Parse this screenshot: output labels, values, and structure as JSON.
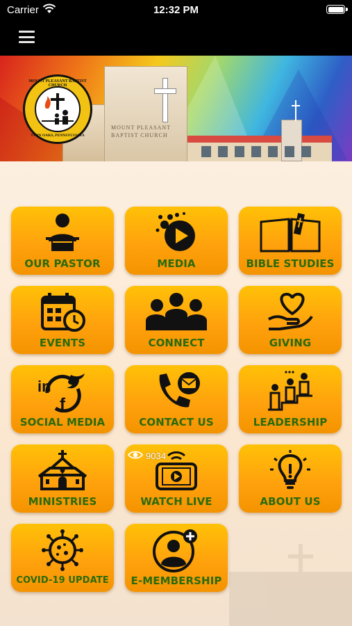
{
  "status_bar": {
    "carrier": "Carrier",
    "time": "12:32 PM"
  },
  "nav": {
    "menu_icon": "hamburger-menu-icon"
  },
  "hero": {
    "logo_text_top": "MOUNT PLEASANT BAPTIST CHURCH",
    "logo_text_bottom": "TWIN OAKS, PENNSYLVANIA",
    "sign_line1": "MOUNT PLEASANT",
    "sign_line2": "BAPTIST CHURCH"
  },
  "tiles": [
    {
      "label": "OUR PASTOR",
      "icon": "pastor-podium-icon"
    },
    {
      "label": "MEDIA",
      "icon": "media-play-icon"
    },
    {
      "label": "BIBLE STUDIES",
      "icon": "open-bible-icon"
    },
    {
      "label": "EVENTS",
      "icon": "calendar-clock-icon"
    },
    {
      "label": "CONNECT",
      "icon": "people-group-icon"
    },
    {
      "label": "GIVING",
      "icon": "hand-heart-icon"
    },
    {
      "label": "SOCIAL MEDIA",
      "icon": "social-media-icon"
    },
    {
      "label": "CONTACT US",
      "icon": "phone-mail-icon"
    },
    {
      "label": "LEADERSHIP",
      "icon": "leadership-stairs-icon"
    },
    {
      "label": "MINISTRIES",
      "icon": "church-building-icon"
    },
    {
      "label": "WATCH LIVE",
      "icon": "live-stream-tablet-icon"
    },
    {
      "label": "ABOUT US",
      "icon": "lightbulb-icon"
    },
    {
      "label": "COVID-19 UPDATE",
      "icon": "virus-icon"
    },
    {
      "label": "E-MEMBERSHIP",
      "icon": "add-member-icon"
    }
  ],
  "viewer_count": "9034",
  "colors": {
    "tile_top": "#ffc107",
    "tile_bottom": "#f49300",
    "label_green": "#2a6a0c",
    "nav_bg": "#000000"
  }
}
